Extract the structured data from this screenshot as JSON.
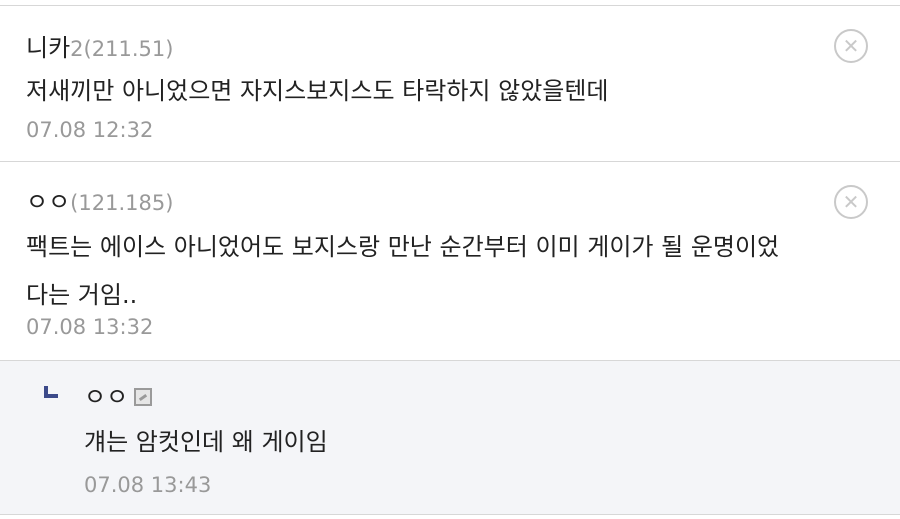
{
  "comments": [
    {
      "nick": "니카",
      "badge": "2",
      "ip": "(211.51)",
      "text": "저새끼만 아니었으면 자지스보지스도 타락하지 않았을텐데",
      "date": "07.08 12:32",
      "delete_icon": "close-circle-icon"
    },
    {
      "nick": "ㅇㅇ",
      "ip": "(121.185)",
      "text_line1": "팩트는 에이스 아니었어도 보지스랑 만난 순간부터 이미 게이가 될 운명이었",
      "text_line2": "다는 거임..",
      "date": "07.08 13:32",
      "delete_icon": "close-circle-icon"
    }
  ],
  "reply": {
    "nick": "ㅇㅇ",
    "text": "걔는 암컷인데 왜 게이임",
    "date": "07.08 13:43",
    "icon": "image-icon"
  },
  "colors": {
    "divider": "#d7d7d7",
    "meta": "#999999",
    "reply_bg": "#f4f5f8",
    "reply_arrow": "#3c4a8a"
  }
}
